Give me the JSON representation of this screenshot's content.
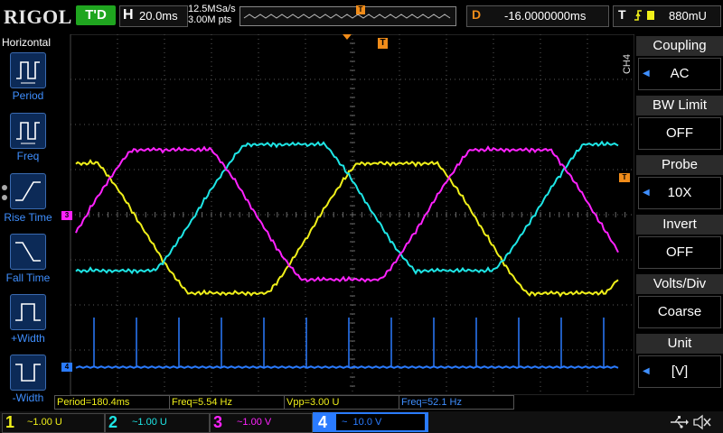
{
  "top": {
    "brand": "RIGOL",
    "run_state": "T'D",
    "timebase_label": "H",
    "timebase_value": "20.0ms",
    "sample_rate": "12.5MSa/s",
    "mem_depth": "3.00M pts",
    "trigger_marker": "T",
    "delay_label": "D",
    "delay_value": "-16.0000000ms",
    "trigger_label": "T",
    "trigger_level": "880mU"
  },
  "left_menu": {
    "title": "Horizontal",
    "items": [
      "Period",
      "Freq",
      "Rise Time",
      "Fall Time",
      "+Width",
      "-Width"
    ]
  },
  "right_menu": {
    "channel_tag": "CH4",
    "items": [
      {
        "label": "Coupling",
        "value": "AC"
      },
      {
        "label": "BW Limit",
        "value": "OFF"
      },
      {
        "label": "Probe",
        "value": "10X"
      },
      {
        "label": "Invert",
        "value": "OFF"
      },
      {
        "label": "Volts/Div",
        "value": "Coarse"
      },
      {
        "label": "Unit",
        "value": "[V]"
      }
    ]
  },
  "measurements": [
    {
      "text": "Period=180.4ms",
      "color": "#f0f01a"
    },
    {
      "text": "Freq=5.54 Hz",
      "color": "#f0f01a"
    },
    {
      "text": "Vpp=3.00 U",
      "color": "#f0f01a"
    },
    {
      "text": "Freq=52.1 Hz",
      "color": "#3f8fff"
    }
  ],
  "channels": [
    {
      "num": "1",
      "scale": "~1.00 U",
      "color": "#f0f01a"
    },
    {
      "num": "2",
      "scale": "~1.00 U",
      "color": "#1ee6e6"
    },
    {
      "num": "3",
      "scale": "~1.00 V",
      "color": "#ff22ff"
    },
    {
      "num": "4",
      "scale": "~  10.0 V",
      "color": "#2a7bff"
    }
  ],
  "channel_markers": {
    "ch3": "3",
    "ch4": "4",
    "trig": "T"
  },
  "colors": {
    "ch1": "#f0f01a",
    "ch2": "#1ee6e6",
    "ch3": "#ff22ff",
    "ch4": "#2a7bff",
    "trigger": "#f08c1a",
    "run": "#1fa51f"
  },
  "icons": [
    "usb-icon",
    "speaker-mute-icon"
  ]
}
